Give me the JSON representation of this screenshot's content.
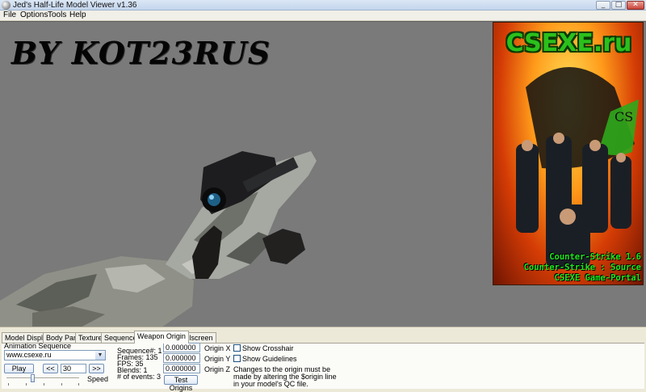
{
  "window": {
    "title": "Jed's Half-Life Model Viewer v1.36",
    "controls": {
      "minimize": "_",
      "maximize": "□",
      "close": "✕"
    }
  },
  "menu": [
    "File",
    "Options",
    "Tools",
    "Help"
  ],
  "viewport": {
    "watermark": "BY KOT23RUS",
    "banner": {
      "title": "CSEXE.ru",
      "badge": "CS",
      "taglines": [
        "Counter-Strike 1.6",
        "Counter-Strike : Source",
        "CSEXE Game-Portal"
      ]
    }
  },
  "tabs": [
    "Model Display",
    "Body Parts",
    "Textures",
    "Sequences",
    "Weapon Origin",
    "Fullscreen"
  ],
  "active_tab": "Weapon Origin",
  "animation": {
    "label": "Animation Sequence",
    "selected": "www.csexe.ru",
    "play_label": "Play",
    "prev_label": "<<",
    "frame_value": "30",
    "next_label": ">>",
    "speed_label": "Speed",
    "speed_level": 0.35
  },
  "sequence_info": {
    "sequence": "Sequence#: 1",
    "frames": "Frames: 135",
    "fps": "FPS: 35",
    "blends": "Blends: 1",
    "events": "# of events: 3"
  },
  "origin": {
    "x_value": "0.000000",
    "x_label": "Origin X",
    "y_value": "0.000000",
    "y_label": "Origin Y",
    "z_value": "0.000000",
    "z_label": "Origin Z",
    "test_label": "Test Origins"
  },
  "options": {
    "show_crosshair": "Show Crosshair",
    "show_guidelines": "Show Guidelines",
    "note_lines": [
      "Changes to the origin must be",
      "made by altering the $origin line",
      "in your model's QC file."
    ]
  },
  "colors": {
    "viewport_bg": "#7a7a7a",
    "panel_bg": "#ece9d8",
    "banner_text": "#2bc01c"
  }
}
